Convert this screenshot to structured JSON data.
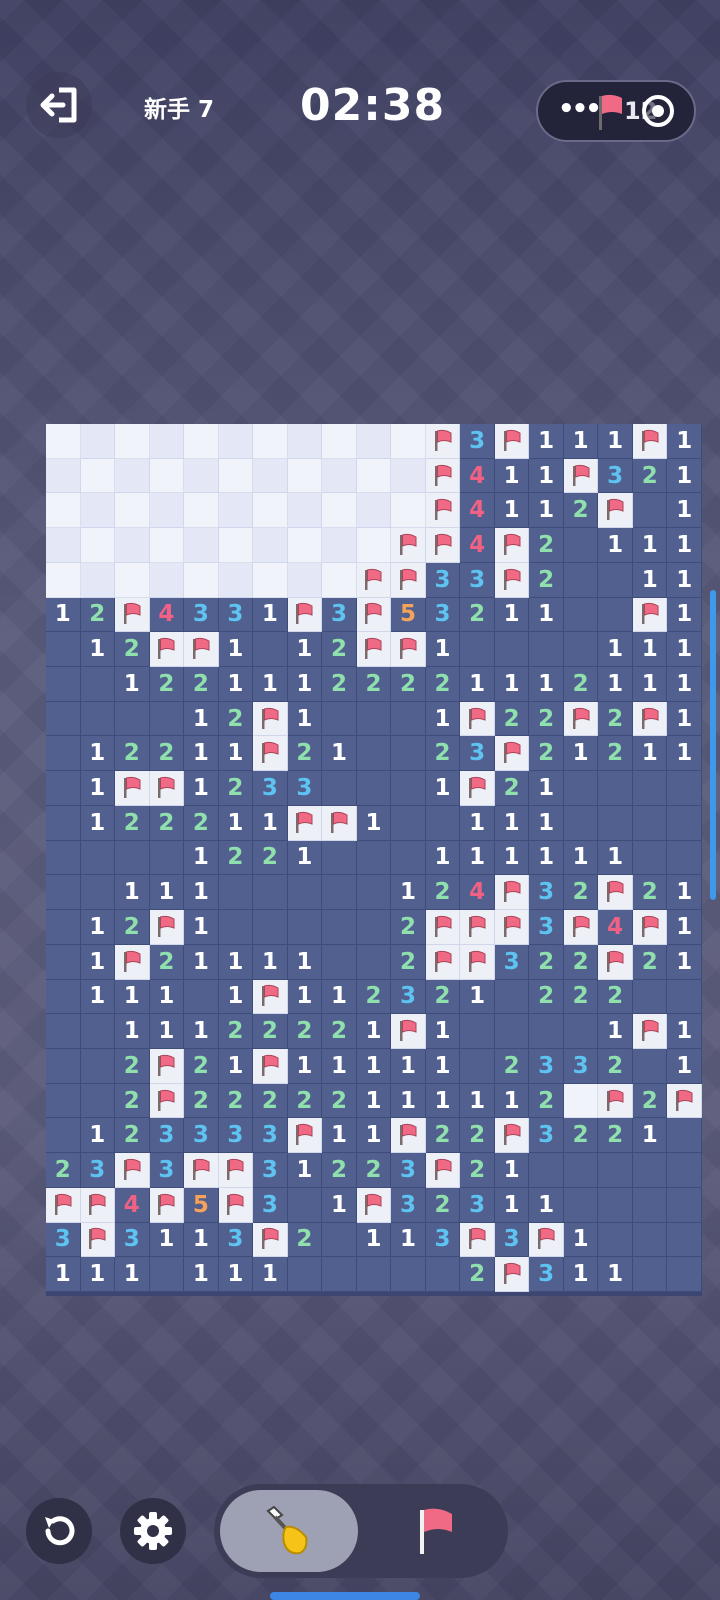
{
  "header": {
    "level_label": "新手 7",
    "timer": "02:38",
    "capsule": {
      "more_label": "•••",
      "flag_count": "12"
    }
  },
  "colors": {
    "number_1": "#ffffff",
    "number_2": "#8fe0ad",
    "number_3": "#5ec3f0",
    "number_4": "#f06184",
    "number_5": "#f5a25b",
    "flag": "#f06a86",
    "board": "#51608f"
  },
  "board": {
    "columns": 19,
    "rows": 25,
    "legend": {
      "#": "unrevealed",
      "F": "flag",
      ".": "revealed-empty",
      "1-8": "revealed-number"
    },
    "grid": [
      "###########F3F111F1",
      "###########F411F321",
      "###########F4112F.1",
      "##########FF4F2.111",
      "#########FF33F2..11",
      "12F4331F3F53211..F1",
      ".12FF1.12FF1....111",
      "..12211122221112111",
      "....12F1...1F22F2F1",
      ".12211F21..23F21211",
      ".1FF1233...1F21....",
      ".122211FF1..111....",
      "....1221...111111..",
      "..111.....124F32F21",
      ".12F1.....2FFF3F4F1",
      ".1F21111..2FF322F21",
      ".111.1F112321.222..",
      "..11122221F1....1F1",
      "..2F21F11111.2332.1",
      "..2F22222111112#F2F1",
      ".123333F11F22F3221.",
      "23F3FF31223F21.....",
      "FF4F5F3.1F32311....",
      "3F3113F2.113F3F1...",
      "111.111.....2F311.."
    ]
  },
  "controls": {
    "undo": "undo",
    "settings": "settings",
    "dig_tool": "shovel",
    "flag_tool": "flag"
  }
}
